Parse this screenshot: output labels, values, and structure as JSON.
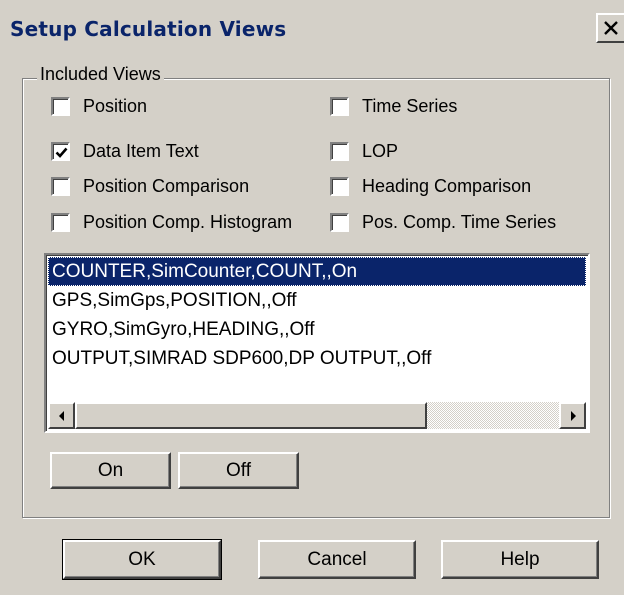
{
  "window": {
    "title": "Setup Calculation Views",
    "close_icon": "close-x-icon"
  },
  "group": {
    "label": "Included Views"
  },
  "checkboxes": [
    {
      "label": "Position",
      "checked": false
    },
    {
      "label": "Time Series",
      "checked": false
    },
    {
      "label": "Data Item Text",
      "checked": true
    },
    {
      "label": "LOP",
      "checked": false
    },
    {
      "label": "Position Comparison",
      "checked": false
    },
    {
      "label": "Heading Comparison",
      "checked": false
    },
    {
      "label": "Position Comp. Histogram",
      "checked": false
    },
    {
      "label": "Pos. Comp. Time Series",
      "checked": false
    }
  ],
  "views_list": {
    "items": [
      {
        "text": "COUNTER,SimCounter,COUNT,,On",
        "selected": true
      },
      {
        "text": "GPS,SimGps,POSITION,,Off",
        "selected": false
      },
      {
        "text": "GYRO,SimGyro,HEADING,,Off",
        "selected": false
      },
      {
        "text": "OUTPUT,SIMRAD SDP600,DP OUTPUT,,Off",
        "selected": false
      }
    ],
    "scroll_left_icon": "scroll-left-arrow-icon",
    "scroll_right_icon": "scroll-right-arrow-icon"
  },
  "toggle_buttons": {
    "on_label": "On",
    "off_label": "Off"
  },
  "dialog_buttons": {
    "ok_label": "OK",
    "cancel_label": "Cancel",
    "help_label": "Help"
  },
  "colors": {
    "face": "#d4d0c8",
    "title_text": "#0a246a",
    "selection": "#0a246a"
  }
}
